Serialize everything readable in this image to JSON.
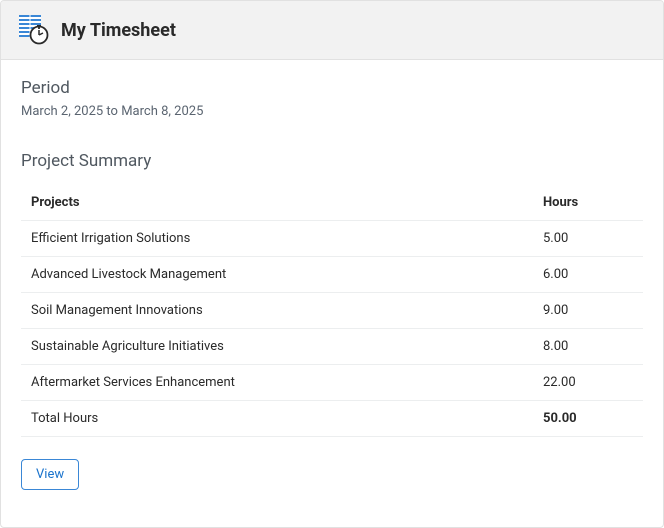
{
  "header": {
    "title": "My Timesheet"
  },
  "period": {
    "label": "Period",
    "text": "March 2, 2025 to March 8, 2025"
  },
  "summary": {
    "title": "Project Summary",
    "columns": {
      "projects": "Projects",
      "hours": "Hours"
    },
    "rows": [
      {
        "project": "Efficient Irrigation Solutions",
        "hours": "5.00"
      },
      {
        "project": "Advanced Livestock Management",
        "hours": "6.00"
      },
      {
        "project": "Soil Management Innovations",
        "hours": "9.00"
      },
      {
        "project": "Sustainable Agriculture Initiatives",
        "hours": "8.00"
      },
      {
        "project": "Aftermarket Services Enhancement",
        "hours": "22.00"
      }
    ],
    "total": {
      "label": "Total Hours",
      "hours": "50.00"
    }
  },
  "actions": {
    "view": "View"
  }
}
